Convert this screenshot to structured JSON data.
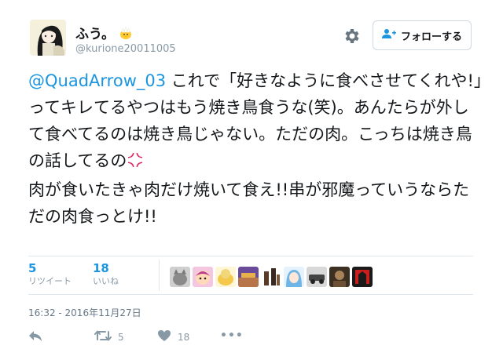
{
  "user": {
    "display_name": "ふう。",
    "handle": "@kurione20011005"
  },
  "follow_label": "フォローする",
  "tweet": {
    "mention": "@QuadArrow_03",
    "text_1": " これで「好きなように食べさせてくれや!」ってキレてるやつはもう焼き鳥食うな(笑)。あんたらが外して食べてるのは焼き鳥じゃない。ただの肉。こっちは焼き鳥の話してるの",
    "text_2": "肉が食いたきゃ肉だけ焼いて食え!!串が邪魔っていうならただの肉食っとけ!!"
  },
  "stats": {
    "retweets": "5",
    "retweets_label": "リツイート",
    "likes": "18",
    "likes_label": "いいね"
  },
  "timestamp": "16:32 - 2016年11月27日",
  "actions": {
    "retweet_count": "5",
    "like_count": "18",
    "more": "•••"
  },
  "colors": {
    "link": "#1b95e0",
    "muted": "#8899a6"
  },
  "icons": [
    "chick-emoji-icon",
    "gear-icon",
    "follow-person-icon",
    "anger-emoji-icon",
    "reply-icon",
    "retweet-icon",
    "heart-icon",
    "more-icon"
  ]
}
